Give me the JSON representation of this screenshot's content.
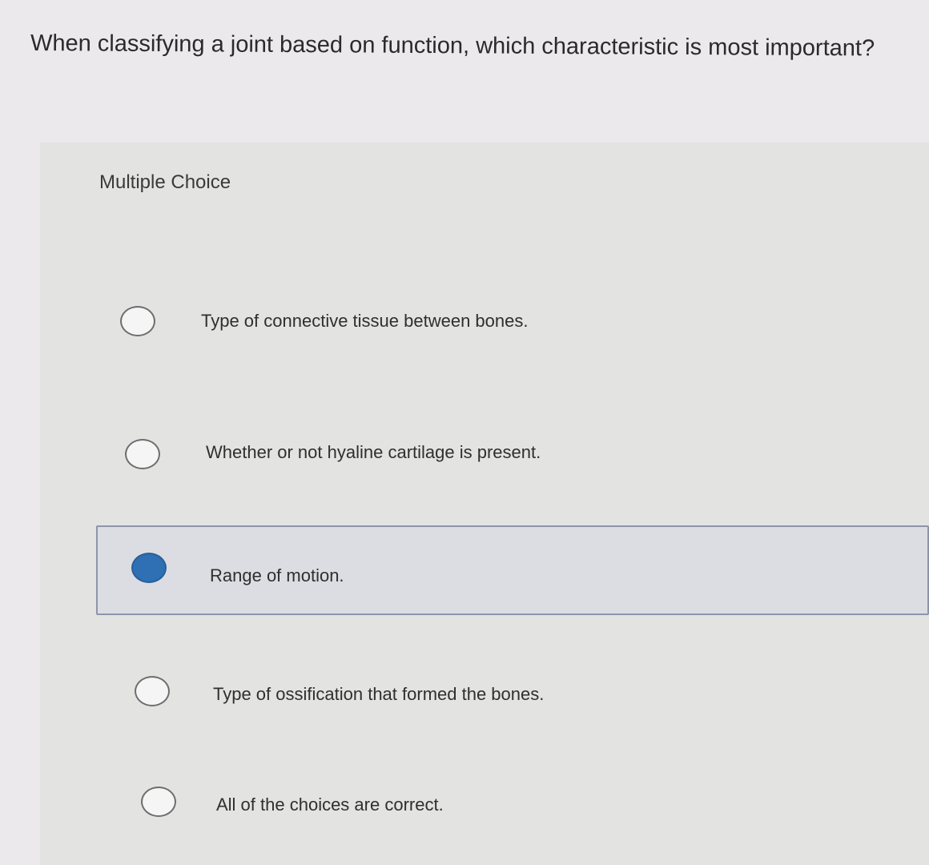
{
  "question": {
    "text": "When classifying a joint based on function, which characteristic is most important?"
  },
  "panel": {
    "label": "Multiple Choice"
  },
  "choices": [
    {
      "text": "Type of connective tissue between bones.",
      "selected": false
    },
    {
      "text": "Whether or not hyaline cartilage is present.",
      "selected": false
    },
    {
      "text": "Range of motion.",
      "selected": true
    },
    {
      "text": "Type of ossification that formed the bones.",
      "selected": false
    },
    {
      "text": "All of the choices are correct.",
      "selected": false
    }
  ],
  "colors": {
    "selected_radio": "#2f6fb4",
    "selected_border": "#8c95aa"
  }
}
